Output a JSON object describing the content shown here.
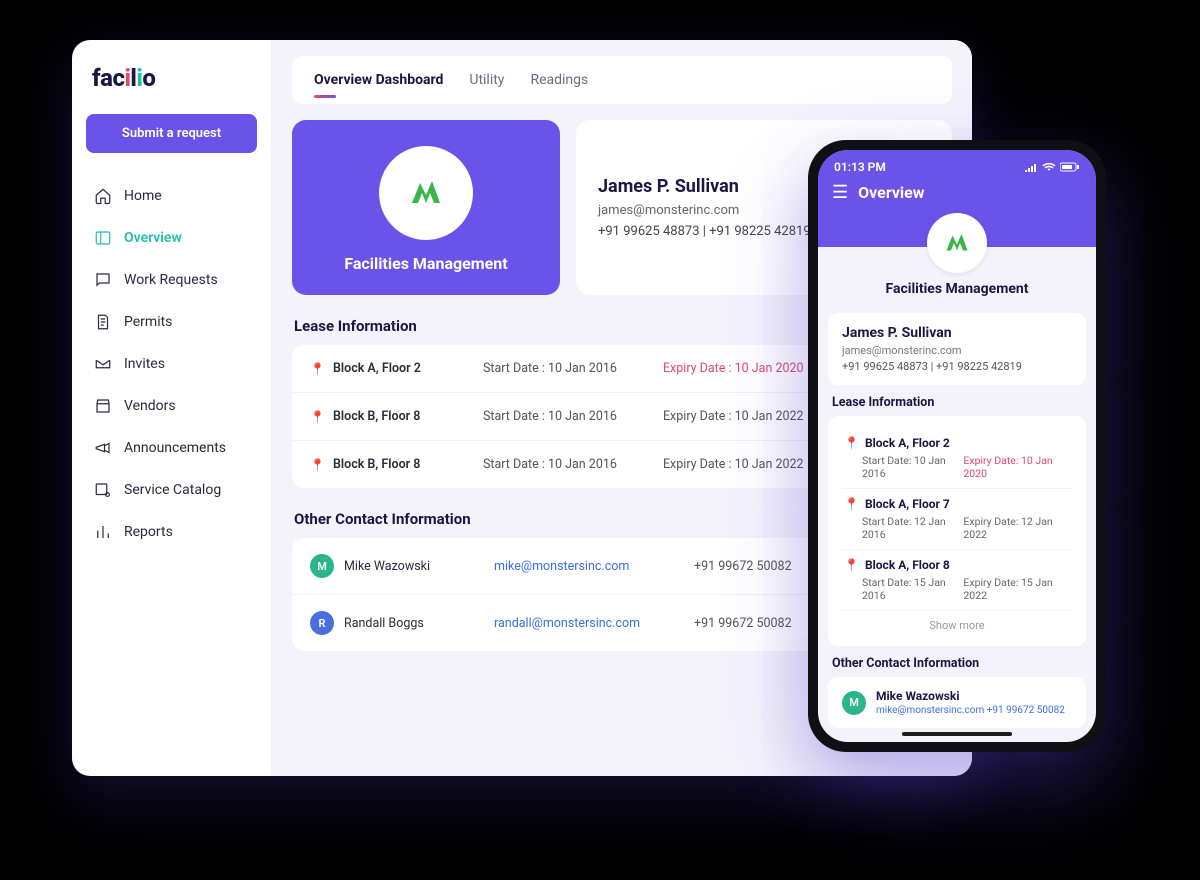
{
  "brand": "facilio",
  "submit_label": "Submit a request",
  "sidebar": {
    "items": [
      {
        "label": "Home"
      },
      {
        "label": "Overview"
      },
      {
        "label": "Work Requests"
      },
      {
        "label": "Permits"
      },
      {
        "label": "Invites"
      },
      {
        "label": "Vendors"
      },
      {
        "label": "Announcements"
      },
      {
        "label": "Service Catalog"
      },
      {
        "label": "Reports"
      }
    ]
  },
  "tabs": [
    {
      "label": "Overview Dashboard"
    },
    {
      "label": "Utility"
    },
    {
      "label": "Readings"
    }
  ],
  "hero": {
    "title": "Facilities Management"
  },
  "contact": {
    "name": "James P. Sullivan",
    "email": "james@monsterinc.com",
    "phones": "+91 99625 48873  |  +91 98225 42819"
  },
  "lease": {
    "title": "Lease Information",
    "rows": [
      {
        "loc": "Block A, Floor 2",
        "start": "Start Date : 10 Jan 2016",
        "exp": "Expiry Date : 10 Jan 2020",
        "expired": true
      },
      {
        "loc": "Block B, Floor 8",
        "start": "Start Date : 10 Jan 2016",
        "exp": "Expiry Date : 10 Jan 2022",
        "expired": false
      },
      {
        "loc": "Block B, Floor 8",
        "start": "Start Date : 10 Jan 2016",
        "exp": "Expiry Date : 10 Jan 2022",
        "expired": false
      }
    ]
  },
  "other": {
    "title": "Other Contact Information",
    "rows": [
      {
        "initial": "M",
        "color": "#2bb58a",
        "name": "Mike Wazowski",
        "email": "mike@monstersinc.com",
        "phone": "+91 99672 50082"
      },
      {
        "initial": "R",
        "color": "#4a6fe0",
        "name": "Randall Boggs",
        "email": "randall@monstersinc.com",
        "phone": "+91 99672 50082"
      }
    ]
  },
  "phone": {
    "time": "01:13 PM",
    "header": "Overview",
    "hero_title": "Facilities Management",
    "contact": {
      "name": "James P. Sullivan",
      "email": "james@monsterinc.com",
      "phones": "+91 99625 48873  |  +91 98225 42819"
    },
    "lease_title": "Lease Information",
    "lease": [
      {
        "loc": "Block A, Floor 2",
        "start": "Start Date: 10 Jan 2016",
        "exp": "Expiry Date: 10 Jan 2020",
        "expired": true
      },
      {
        "loc": "Block A, Floor 7",
        "start": "Start Date: 12 Jan 2016",
        "exp": "Expiry Date: 12 Jan 2022",
        "expired": false
      },
      {
        "loc": "Block A, Floor 8",
        "start": "Start Date: 15 Jan 2016",
        "exp": "Expiry Date: 15 Jan 2022",
        "expired": false
      }
    ],
    "show_more": "Show more",
    "other_title": "Other Contact Information",
    "other": {
      "initial": "M",
      "name": "Mike Wazowski",
      "sub": "mike@monstersinc.com    +91 99672 50082"
    }
  }
}
